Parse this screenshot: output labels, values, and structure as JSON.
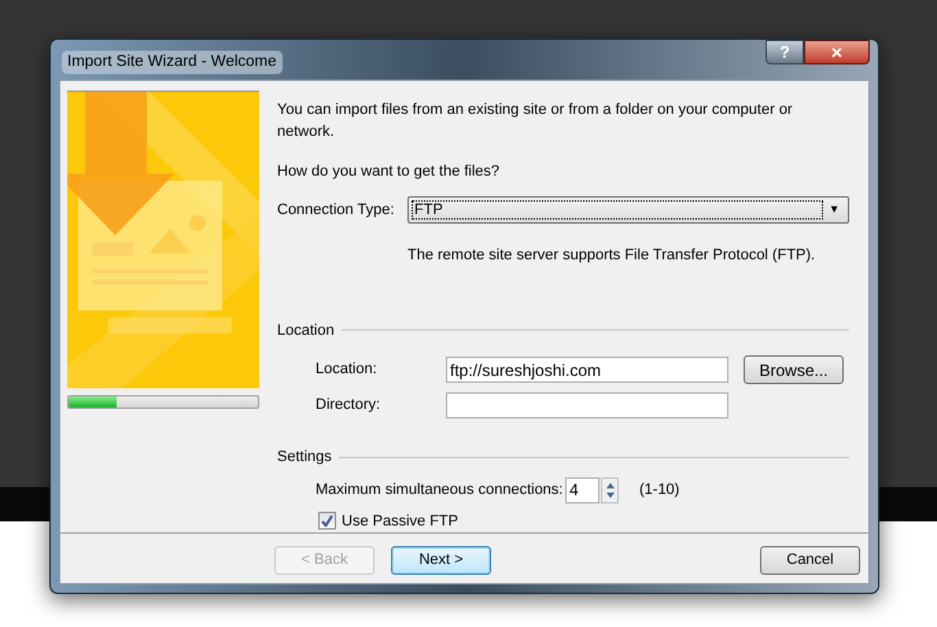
{
  "window": {
    "title": "Import Site Wizard - Welcome",
    "help_button": "?",
    "close_button": "×"
  },
  "progress": {
    "level": 0.25
  },
  "intro": "You can import files from an existing site or from a folder on your computer or network.",
  "question": "How do you want to get the files?",
  "connection_type": {
    "label": "Connection Type:",
    "value": "FTP",
    "arrow": "▼"
  },
  "connection_note": "The remote site server supports File Transfer Protocol (FTP).",
  "location_group": {
    "title": "Location",
    "location": {
      "label": "Location:",
      "value": "ftp://sureshjoshi.com"
    },
    "browse_button": "Browse...",
    "directory": {
      "label": "Directory:"
    }
  },
  "settings_group": {
    "title": "Settings",
    "connections": {
      "label": "Maximum simultaneous connections:",
      "value": "4",
      "range": "(1-10)"
    },
    "passive_ftp": {
      "label": "Use Passive FTP",
      "checked": true
    }
  },
  "buttons": [
    {
      "label": "< Back",
      "disabled": true,
      "default": false
    },
    {
      "label": "Next >",
      "disabled": false,
      "default": true
    },
    {
      "label": "Cancel",
      "disabled": false,
      "default": false
    }
  ]
}
